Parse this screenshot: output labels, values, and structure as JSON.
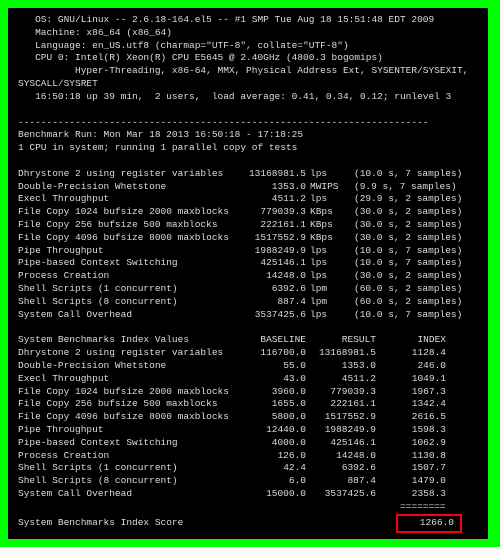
{
  "header": {
    "os_line": "   OS: GNU/Linux -- 2.6.18-164.el5 -- #1 SMP Tue Aug 18 15:51:48 EDT 2009",
    "machine_line": "   Machine: x86_64 (x86_64)",
    "language_line": "   Language: en_US.utf8 (charmap=\"UTF-8\", collate=\"UTF-8\")",
    "cpu_line": "   CPU 0: Intel(R) Xeon(R) CPU E5645 @ 2.40GHz (4800.3 bogomips)",
    "cpu_feat_line": "          Hyper-Threading, x86-64, MMX, Physical Address Ext, SYSENTER/SYSEXIT,",
    "syscall_line": "SYSCALL/SYSRET",
    "uptime_line": "   16:50:18 up 39 min,  2 users,  load average: 0.41, 0.34, 0.12; runlevel 3"
  },
  "divider": "------------------------------------------------------------------------",
  "run_header": {
    "run_line": "Benchmark Run: Mon Mar 18 2013 16:50:18 - 17:18:25",
    "cpu_count_line": "1 CPU in system; running 1 parallel copy of tests"
  },
  "benchmarks": [
    {
      "name": "Dhrystone 2 using register variables",
      "value": "13168981.5",
      "unit": "lps",
      "extra": "(10.0 s, 7 samples)"
    },
    {
      "name": "Double-Precision Whetstone",
      "value": "1353.0",
      "unit": "MWIPS",
      "extra": "(9.9 s, 7 samples)"
    },
    {
      "name": "Execl Throughput",
      "value": "4511.2",
      "unit": "lps",
      "extra": "(29.9 s, 2 samples)"
    },
    {
      "name": "File Copy 1024 bufsize 2000 maxblocks",
      "value": "779039.3",
      "unit": "KBps",
      "extra": "(30.0 s, 2 samples)"
    },
    {
      "name": "File Copy 256 bufsize 500 maxblocks",
      "value": "222161.1",
      "unit": "KBps",
      "extra": "(30.0 s, 2 samples)"
    },
    {
      "name": "File Copy 4096 bufsize 8000 maxblocks",
      "value": "1517552.9",
      "unit": "KBps",
      "extra": "(30.0 s, 2 samples)"
    },
    {
      "name": "Pipe Throughput",
      "value": "1988249.9",
      "unit": "lps",
      "extra": "(10.0 s, 7 samples)"
    },
    {
      "name": "Pipe-based Context Switching",
      "value": "425146.1",
      "unit": "lps",
      "extra": "(10.0 s, 7 samples)"
    },
    {
      "name": "Process Creation",
      "value": "14248.0",
      "unit": "lps",
      "extra": "(30.0 s, 2 samples)"
    },
    {
      "name": "Shell Scripts (1 concurrent)",
      "value": "6392.6",
      "unit": "lpm",
      "extra": "(60.0 s, 2 samples)"
    },
    {
      "name": "Shell Scripts (8 concurrent)",
      "value": "887.4",
      "unit": "lpm",
      "extra": "(60.0 s, 2 samples)"
    },
    {
      "name": "System Call Overhead",
      "value": "3537425.6",
      "unit": "lps",
      "extra": "(10.0 s, 7 samples)"
    }
  ],
  "index_header": {
    "title": "System Benchmarks Index Values",
    "c1": "BASELINE",
    "c2": "RESULT",
    "c3": "INDEX"
  },
  "indexes": [
    {
      "name": "Dhrystone 2 using register variables",
      "baseline": "116700.0",
      "result": "13168981.5",
      "index": "1128.4"
    },
    {
      "name": "Double-Precision Whetstone",
      "baseline": "55.0",
      "result": "1353.0",
      "index": "246.0"
    },
    {
      "name": "Execl Throughput",
      "baseline": "43.0",
      "result": "4511.2",
      "index": "1049.1"
    },
    {
      "name": "File Copy 1024 bufsize 2000 maxblocks",
      "baseline": "3960.0",
      "result": "779039.3",
      "index": "1967.3"
    },
    {
      "name": "File Copy 256 bufsize 500 maxblocks",
      "baseline": "1655.0",
      "result": "222161.1",
      "index": "1342.4"
    },
    {
      "name": "File Copy 4096 bufsize 8000 maxblocks",
      "baseline": "5800.0",
      "result": "1517552.9",
      "index": "2616.5"
    },
    {
      "name": "Pipe Throughput",
      "baseline": "12440.0",
      "result": "1988249.9",
      "index": "1598.3"
    },
    {
      "name": "Pipe-based Context Switching",
      "baseline": "4000.0",
      "result": "425146.1",
      "index": "1062.9"
    },
    {
      "name": "Process Creation",
      "baseline": "126.0",
      "result": "14248.0",
      "index": "1130.8"
    },
    {
      "name": "Shell Scripts (1 concurrent)",
      "baseline": "42.4",
      "result": "6392.6",
      "index": "1507.7"
    },
    {
      "name": "Shell Scripts (8 concurrent)",
      "baseline": "6.0",
      "result": "887.4",
      "index": "1479.0"
    },
    {
      "name": "System Call Overhead",
      "baseline": "15000.0",
      "result": "3537425.6",
      "index": "2358.3"
    }
  ],
  "score_sep": "                                                                   ========",
  "score": {
    "label": "System Benchmarks Index Score",
    "value": "1266.0"
  }
}
